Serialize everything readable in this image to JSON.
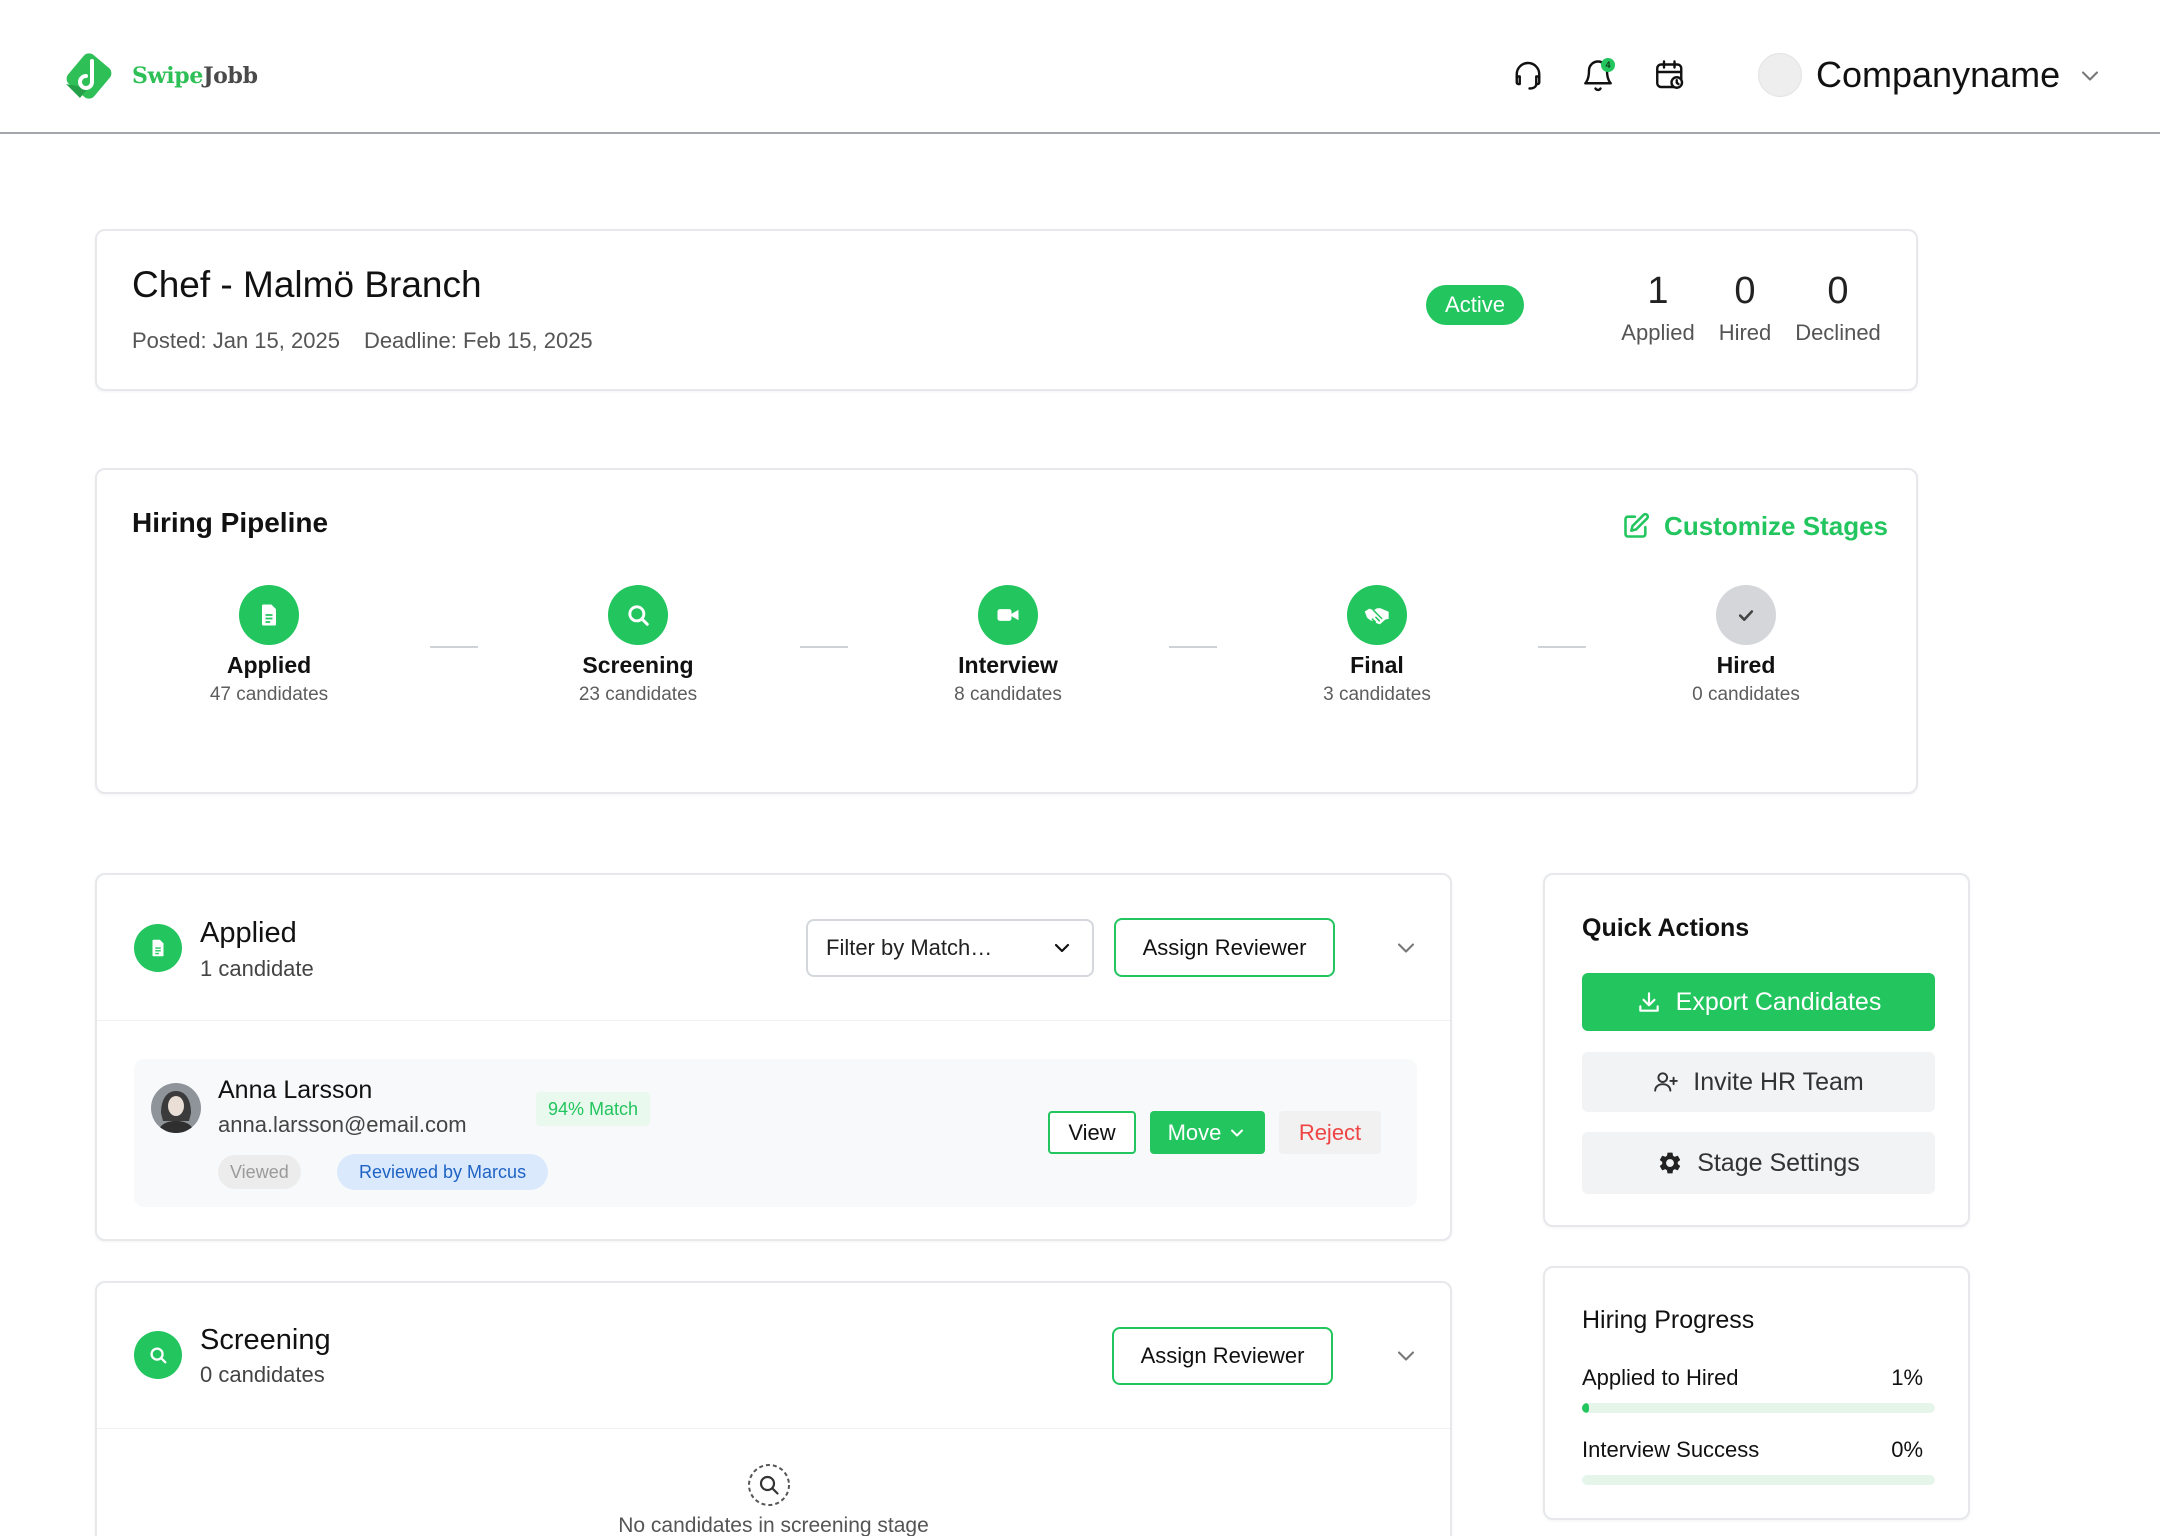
{
  "header": {
    "brand_primary": "Swipe",
    "brand_secondary": "Jobb",
    "notification_count": "4",
    "company_name": "Companyname",
    "icons": [
      "headset-icon",
      "bell-icon",
      "calendar-icon",
      "chevron-down-icon"
    ]
  },
  "job": {
    "title": "Chef - Malmö Branch",
    "posted": "Posted: Jan 15, 2025",
    "deadline": "Deadline: Feb 15, 2025",
    "status": "Active",
    "stats": [
      {
        "value": "1",
        "label": "Applied"
      },
      {
        "value": "0",
        "label": "Hired"
      },
      {
        "value": "0",
        "label": "Declined"
      }
    ]
  },
  "pipeline": {
    "title": "Hiring Pipeline",
    "customize_label": "Customize Stages",
    "stages": [
      {
        "name": "Applied",
        "count": "47 candidates",
        "icon": "document-icon",
        "state": "active"
      },
      {
        "name": "Screening",
        "count": "23 candidates",
        "icon": "search-icon",
        "state": "active"
      },
      {
        "name": "Interview",
        "count": "8 candidates",
        "icon": "video-icon",
        "state": "active"
      },
      {
        "name": "Final",
        "count": "3 candidates",
        "icon": "handshake-icon",
        "state": "active"
      },
      {
        "name": "Hired",
        "count": "0 candidates",
        "icon": "check-icon",
        "state": "inactive"
      }
    ]
  },
  "sections": {
    "applied": {
      "title": "Applied",
      "count": "1 candidate",
      "filter": "Filter by Match…",
      "assign_label": "Assign Reviewer",
      "candidates": [
        {
          "name": "Anna Larsson",
          "email": "anna.larsson@email.com",
          "match": "94% Match",
          "tags": [
            "Viewed",
            "Reviewed by Marcus"
          ],
          "view_label": "View",
          "move_label": "Move",
          "reject_label": "Reject"
        }
      ]
    },
    "screening": {
      "title": "Screening",
      "count": "0 candidates",
      "assign_label": "Assign Reviewer",
      "empty_text": "No candidates in screening stage"
    }
  },
  "quick_actions": {
    "title": "Quick Actions",
    "export_label": "Export Candidates",
    "invite_label": "Invite HR Team",
    "settings_label": "Stage Settings"
  },
  "hiring_progress": {
    "title": "Hiring Progress",
    "metrics": [
      {
        "label": "Applied to Hired",
        "value": "1%",
        "progress": 0.01
      },
      {
        "label": "Interview Success",
        "value": "0%",
        "progress": 0
      }
    ]
  },
  "colors": {
    "accent": "#22c55e",
    "reject": "#ef4444",
    "reviewed_badge": "#1e63c4"
  }
}
